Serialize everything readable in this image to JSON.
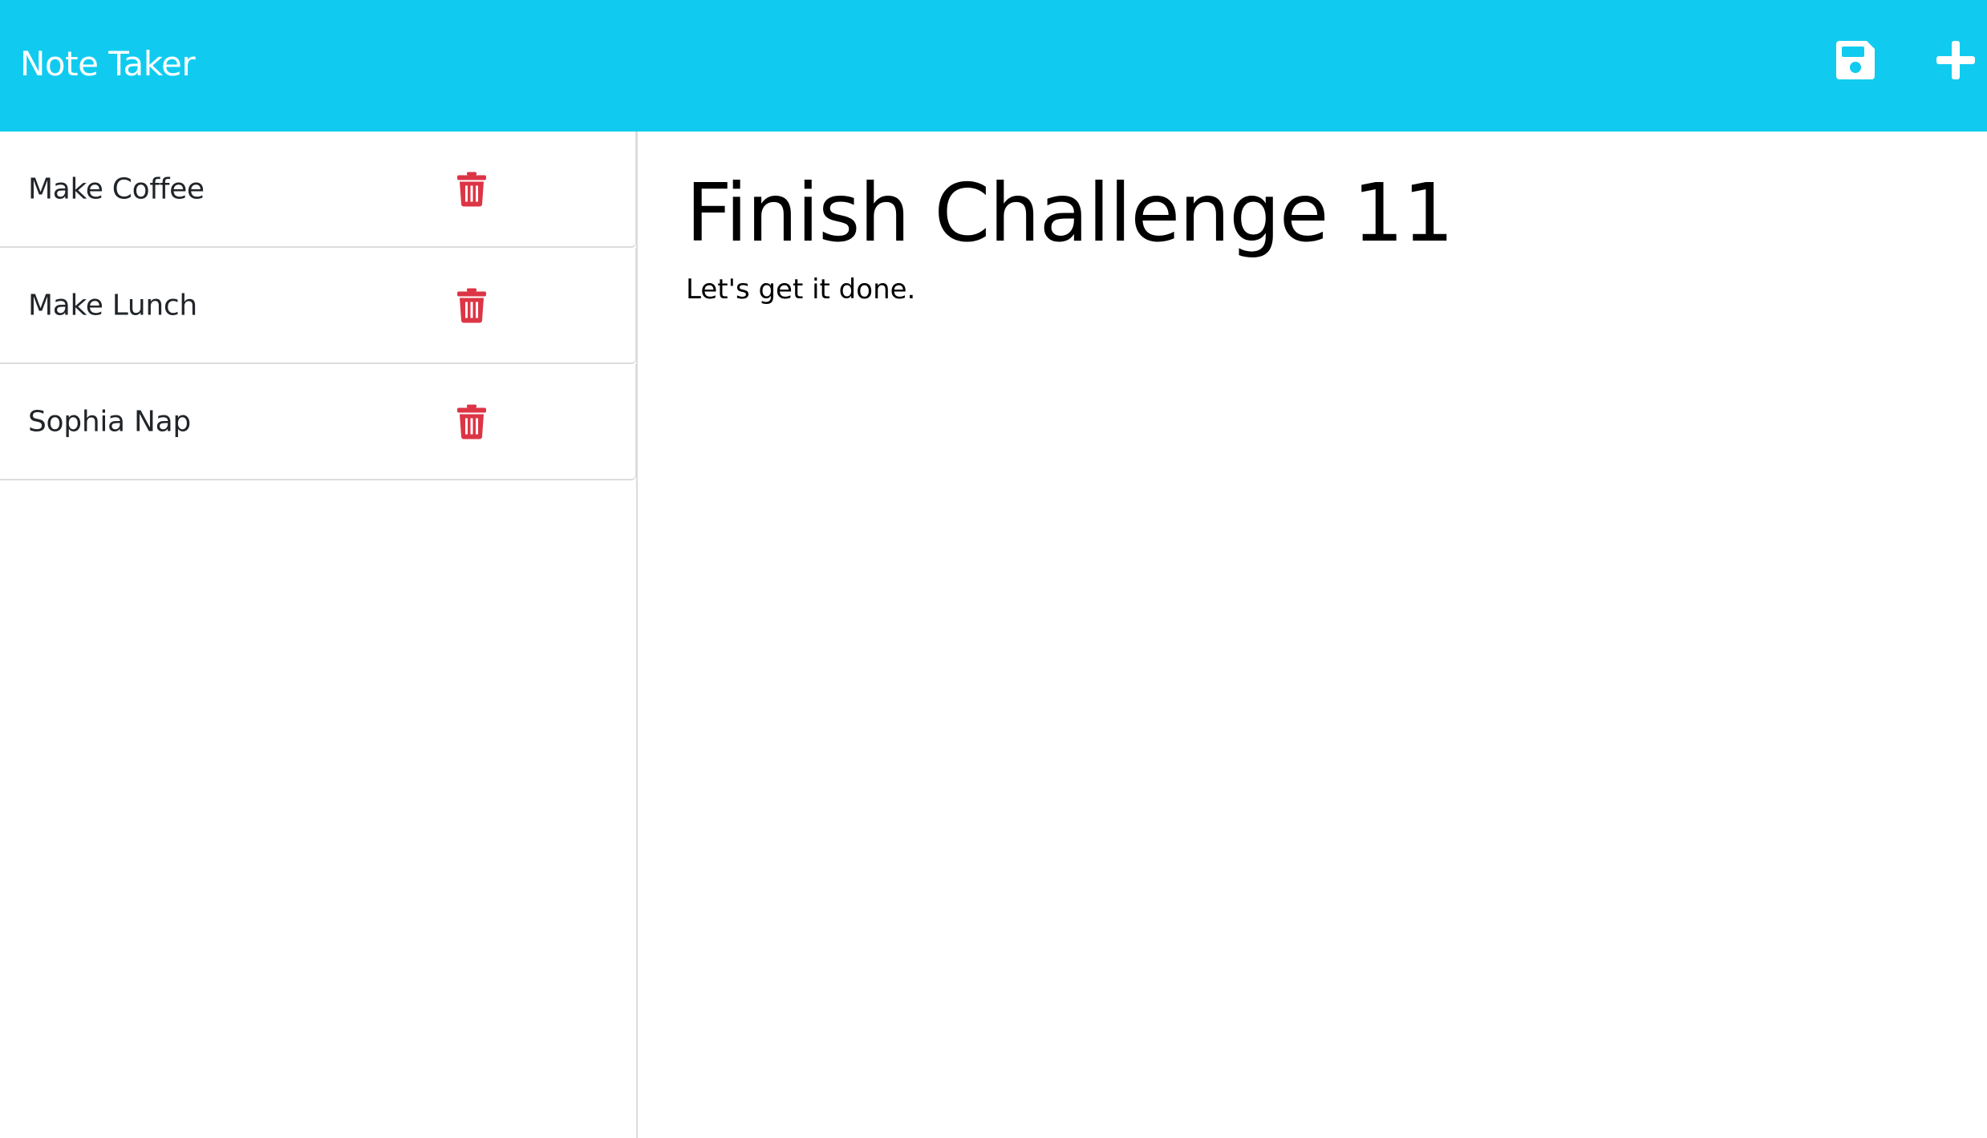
{
  "header": {
    "title": "Note Taker",
    "background_color": "#10cbef",
    "save_icon": "floppy-disk-icon",
    "new_icon": "plus-icon"
  },
  "notes": [
    {
      "title": "Make Coffee",
      "delete_icon": "trash-icon"
    },
    {
      "title": "Make Lunch",
      "delete_icon": "trash-icon"
    },
    {
      "title": "Sophia Nap",
      "delete_icon": "trash-icon"
    }
  ],
  "editor": {
    "title": "Finish Challenge 11",
    "text": "Let's get it done."
  },
  "colors": {
    "accent": "#10cbef",
    "delete": "#dc3545"
  }
}
